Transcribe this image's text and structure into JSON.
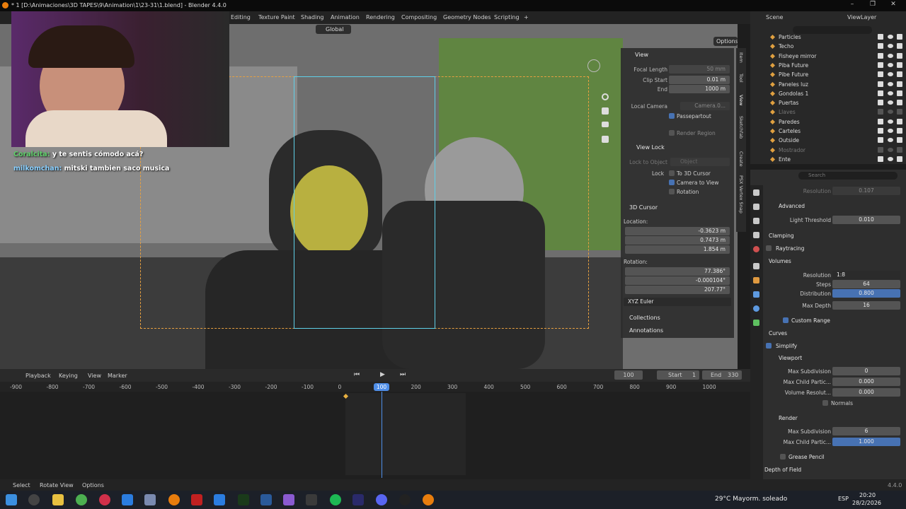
{
  "window": {
    "title": "* 1 [D:\\Animaciones\\3D TAPES\\9\\Animation\\1\\23-31\\1.blend] - Blender 4.4.0"
  },
  "workspaces": [
    "Editing",
    "Texture Paint",
    "Shading",
    "Animation",
    "Rendering",
    "Compositing",
    "Geometry Nodes",
    "Scripting"
  ],
  "viewport_header": {
    "orientation": "Global",
    "options": "Options"
  },
  "chat": [
    {
      "user": "Coralcita:",
      "text": "y te sentis cómodo acá?"
    },
    {
      "user": "milkomchan:",
      "text": "mitski tambien saco musica"
    }
  ],
  "npanel": {
    "view_title": "View",
    "focal_length_label": "Focal Length",
    "focal_length": "50 mm",
    "clip_start_label": "Clip Start",
    "clip_start": "0.01 m",
    "end_label": "End",
    "end": "1000 m",
    "local_camera_label": "Local Camera",
    "local_camera": "Camera.0...",
    "passepartout": "Passepartout",
    "render_region": "Render Region",
    "view_lock_title": "View Lock",
    "lock_to_object_label": "Lock to Object",
    "lock_to_object": "Object",
    "lock_label": "Lock",
    "to_3d_cursor": "To 3D Cursor",
    "camera_to_view": "Camera to View",
    "rotation_opt": "Rotation",
    "cursor_title": "3D Cursor",
    "location_label": "Location:",
    "loc_x": "-0.3623 m",
    "loc_y": "0.7473 m",
    "loc_z": "1.854 m",
    "rotation_label": "Rotation:",
    "rot_x": "77.386°",
    "rot_y": "-0.000104°",
    "rot_z": "207.77°",
    "rot_mode": "XYZ Euler",
    "collections": "Collections",
    "annotations": "Annotations",
    "x": "X",
    "y": "Y",
    "z": "Z"
  },
  "ntabs": [
    "Item",
    "Tool",
    "View",
    "Sketchfab",
    "Create",
    "PSX Vertex Snap"
  ],
  "outliner": {
    "scene": "Scene",
    "viewlayer": "ViewLayer",
    "items": [
      {
        "name": "Particles",
        "dim": false
      },
      {
        "name": "Techo",
        "dim": false
      },
      {
        "name": "Fisheye mirror",
        "dim": false
      },
      {
        "name": "Piba Future",
        "dim": false
      },
      {
        "name": "Pibe Future",
        "dim": false
      },
      {
        "name": "Paneles luz",
        "dim": false
      },
      {
        "name": "Gondolas 1",
        "dim": false
      },
      {
        "name": "Puertas",
        "dim": false
      },
      {
        "name": "Llaves",
        "dim": true
      },
      {
        "name": "Paredes",
        "dim": false
      },
      {
        "name": "Carteles",
        "dim": false
      },
      {
        "name": "Outside",
        "dim": false
      },
      {
        "name": "Mostrador",
        "dim": true
      },
      {
        "name": "Ente",
        "dim": false
      }
    ]
  },
  "properties": {
    "search_placeholder": "Search",
    "resolution_label": "Resolution",
    "resolution_top": "0.107",
    "advanced": "Advanced",
    "light_threshold_label": "Light Threshold",
    "light_threshold": "0.010",
    "clamping": "Clamping",
    "raytracing": "Raytracing",
    "volumes": "Volumes",
    "vol_resolution": "1:8",
    "steps_label": "Steps",
    "steps": "64",
    "distribution_label": "Distribution",
    "distribution": "0.800",
    "max_depth_label": "Max Depth",
    "max_depth": "16",
    "custom_range": "Custom Range",
    "curves": "Curves",
    "simplify": "Simplify",
    "viewport": "Viewport",
    "max_subdiv_label": "Max Subdivision",
    "max_subdiv_vp": "0",
    "max_child_label": "Max Child Partic...",
    "max_child_vp": "0.000",
    "vol_res_label": "Volume Resolut...",
    "vol_res_vp": "0.000",
    "normals": "Normals",
    "render": "Render",
    "max_subdiv_r": "6",
    "max_child_r": "1.000",
    "grease_pencil": "Grease Pencil",
    "depth_of_field": "Depth of Field"
  },
  "timeline": {
    "playback": "Playback",
    "keying": "Keying",
    "view": "View",
    "marker": "Marker",
    "current_frame": "100",
    "start_label": "Start",
    "start": "1",
    "end_label": "End",
    "end": "330",
    "ticks": [
      "-900",
      "-800",
      "-700",
      "-600",
      "-500",
      "-400",
      "-300",
      "-200",
      "-100",
      "0",
      "100",
      "200",
      "300",
      "400",
      "500",
      "600",
      "700",
      "800",
      "900",
      "1000"
    ],
    "playhead": "100"
  },
  "statusbar": {
    "select": "Select",
    "rotate_view": "Rotate View",
    "options": "Options",
    "version": "4.4.0"
  },
  "taskbar": {
    "weather": "29°C  Mayorm. soleado",
    "lang": "ESP",
    "time": "20:20",
    "date": "28/2/2026"
  }
}
